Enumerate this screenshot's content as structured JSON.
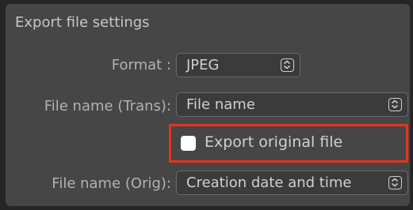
{
  "section": {
    "title": "Export file settings"
  },
  "format": {
    "label": "Format :",
    "value": "JPEG"
  },
  "file_name_trans": {
    "label": "File name (Trans):",
    "value": "File name"
  },
  "export_original": {
    "label": "Export original file",
    "checked": false
  },
  "file_name_orig": {
    "label": "File name (Orig):",
    "value": "Creation date and time"
  },
  "colors": {
    "highlight": "#e8331f",
    "panel": "#464646"
  }
}
